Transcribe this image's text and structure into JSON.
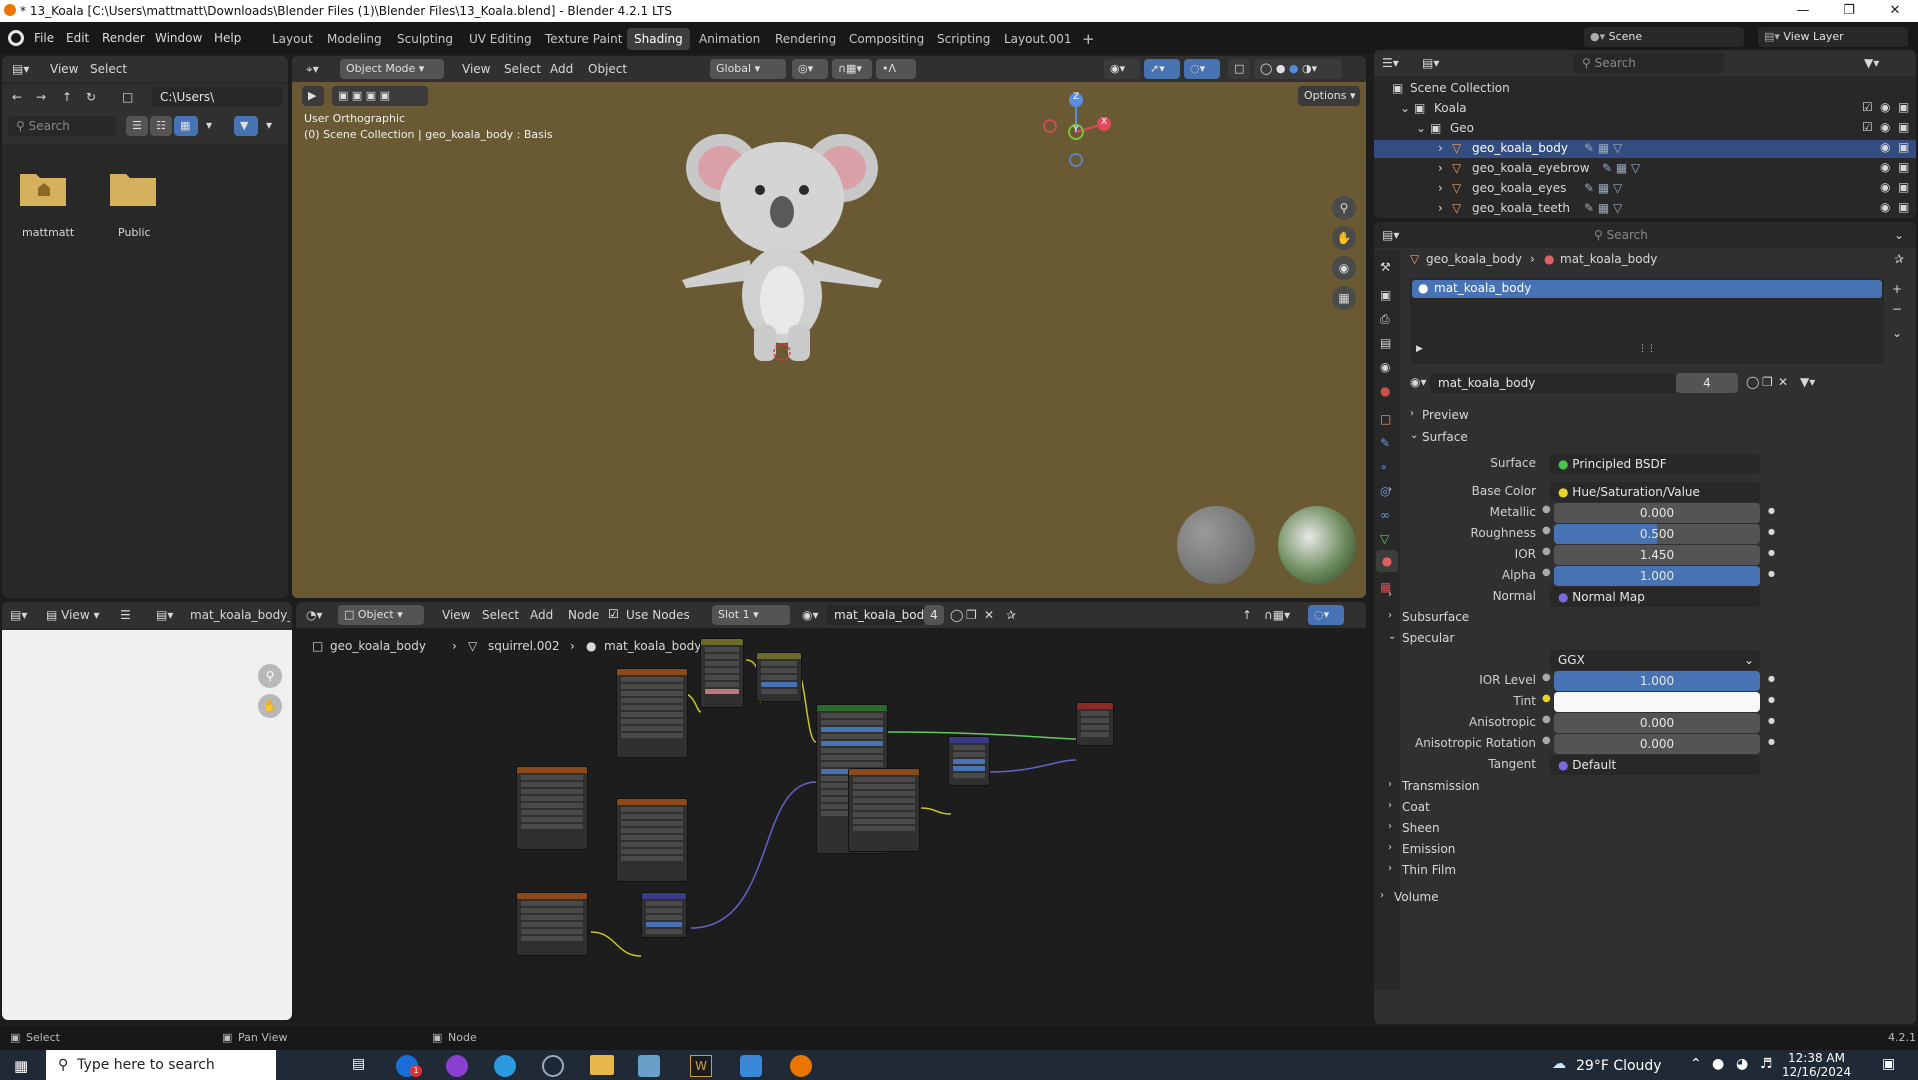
{
  "window": {
    "title": "* 13_Koala [C:\\Users\\mattmatt\\Downloads\\Blender Files (1)\\Blender Files\\13_Koala.blend] - Blender 4.2.1 LTS"
  },
  "menu": [
    "File",
    "Edit",
    "Render",
    "Window",
    "Help"
  ],
  "workspaces": [
    "Layout",
    "Modeling",
    "Sculpting",
    "UV Editing",
    "Texture Paint",
    "Shading",
    "Animation",
    "Rendering",
    "Compositing",
    "Scripting",
    "Layout.001"
  ],
  "active_workspace": "Shading",
  "topright": {
    "scene": "Scene",
    "view_layer": "View Layer"
  },
  "filebrowser": {
    "menus": [
      "View",
      "Select"
    ],
    "path": "C:\\Users\\",
    "search_placeholder": "Search",
    "folders": [
      "mattmatt",
      "Public"
    ]
  },
  "viewport": {
    "mode": "Object Mode",
    "menus": [
      "View",
      "Select",
      "Add",
      "Object"
    ],
    "orientation": "Global",
    "options_label": "Options",
    "info_line1": "User Orthographic",
    "info_line2": "(0) Scene Collection | geo_koala_body : Basis",
    "gizmo_x": "X",
    "gizmo_y": "Y",
    "gizmo_z": "Z"
  },
  "outliner": {
    "search_placeholder": "Search",
    "root": "Scene Collection",
    "items": [
      {
        "label": "Koala",
        "level": 1
      },
      {
        "label": "Geo",
        "level": 2
      },
      {
        "label": "geo_koala_body",
        "level": 3,
        "selected": true
      },
      {
        "label": "geo_koala_eyebrow",
        "level": 3
      },
      {
        "label": "geo_koala_eyes",
        "level": 3
      },
      {
        "label": "geo_koala_teeth",
        "level": 3
      }
    ]
  },
  "properties": {
    "search_placeholder": "Search",
    "breadcrumb_object": "geo_koala_body",
    "breadcrumb_material": "mat_koala_body",
    "slot_name": "mat_koala_body",
    "material_name": "mat_koala_body",
    "user_count": "4",
    "sections": {
      "preview": "Preview",
      "surface": "Surface",
      "subsurface": "Subsurface",
      "specular": "Specular",
      "transmission": "Transmission",
      "coat": "Coat",
      "sheen": "Sheen",
      "emission": "Emission",
      "thin_film": "Thin Film",
      "volume": "Volume"
    },
    "surface_label": "Surface",
    "surface_value": "Principled BSDF",
    "base_color_label": "Base Color",
    "base_color_value": "Hue/Saturation/Value",
    "metallic_label": "Metallic",
    "metallic_value": "0.000",
    "roughness_label": "Roughness",
    "roughness_value": "0.500",
    "ior_label": "IOR",
    "ior_value": "1.450",
    "alpha_label": "Alpha",
    "alpha_value": "1.000",
    "normal_label": "Normal",
    "normal_value": "Normal Map",
    "distribution": "GGX",
    "ior_level_label": "IOR Level",
    "ior_level_value": "1.000",
    "tint_label": "Tint",
    "anisotropic_label": "Anisotropic",
    "anisotropic_value": "0.000",
    "anisotropic_rotation_label": "Anisotropic Rotation",
    "anisotropic_rotation_value": "0.000",
    "tangent_label": "Tangent",
    "tangent_value": "Default"
  },
  "image_editor": {
    "view_label": "View",
    "image_name": "mat_koala_body_Ro"
  },
  "node_editor": {
    "type": "Object",
    "menus": [
      "View",
      "Select",
      "Add",
      "Node"
    ],
    "use_nodes_label": "Use Nodes",
    "slot": "Slot 1",
    "material": "mat_koala_body",
    "users": "4",
    "breadcrumb": [
      "geo_koala_body",
      "squirrel.002",
      "mat_koala_body"
    ]
  },
  "statusbar": {
    "select": "Select",
    "pan": "Pan View",
    "node": "Node",
    "version": "4.2.1"
  },
  "taskbar": {
    "search_placeholder": "Type here to search",
    "weather": "29°F  Cloudy",
    "time": "12:38 AM",
    "date": "12/16/2024",
    "notif_count": "1"
  },
  "colors": {
    "accent": "#4772b3",
    "active_tab": "#3d3d3d",
    "viewport_bg": "#6a5a34"
  }
}
